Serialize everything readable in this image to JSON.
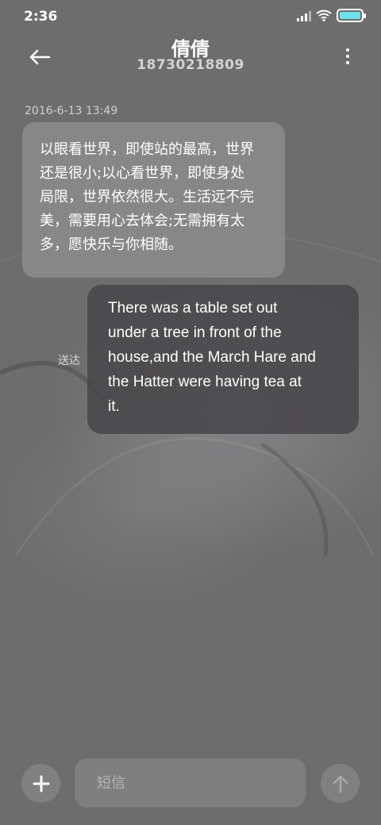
{
  "status_bar": {
    "time": "2:36",
    "icons": [
      "signal-icon",
      "wifi-icon",
      "battery-icon"
    ]
  },
  "header": {
    "back_icon": "arrow-left-icon",
    "contact_name": "倩倩",
    "contact_number": "18730218809",
    "more_icon": "more-vertical-icon"
  },
  "conversation": {
    "timestamp": "2016-6-13 13:49",
    "messages": [
      {
        "direction": "incoming",
        "lines": [
          "以眼看世界，即使站的最高，世界",
          "还是很小;以心看世界，即使身处",
          "局限，世界依然很大。生活远不完",
          "美，需要用心去体会;无需拥有太",
          "多，愿快乐与你相随。"
        ]
      },
      {
        "direction": "outgoing",
        "status": "送达",
        "lines": [
          "There was a table set out",
          "under a tree in front of the",
          "house,and the March Hare and",
          "the Hatter were having tea at",
          "it."
        ]
      }
    ]
  },
  "composer": {
    "add_icon": "plus-icon",
    "placeholder": "短信",
    "value": "",
    "send_icon": "arrow-up-icon"
  },
  "colors": {
    "background": "#6d6d6d",
    "incoming_bubble": "#8c8c8c",
    "outgoing_bubble": "#48484a",
    "battery_fill": "#6fe0e8"
  }
}
